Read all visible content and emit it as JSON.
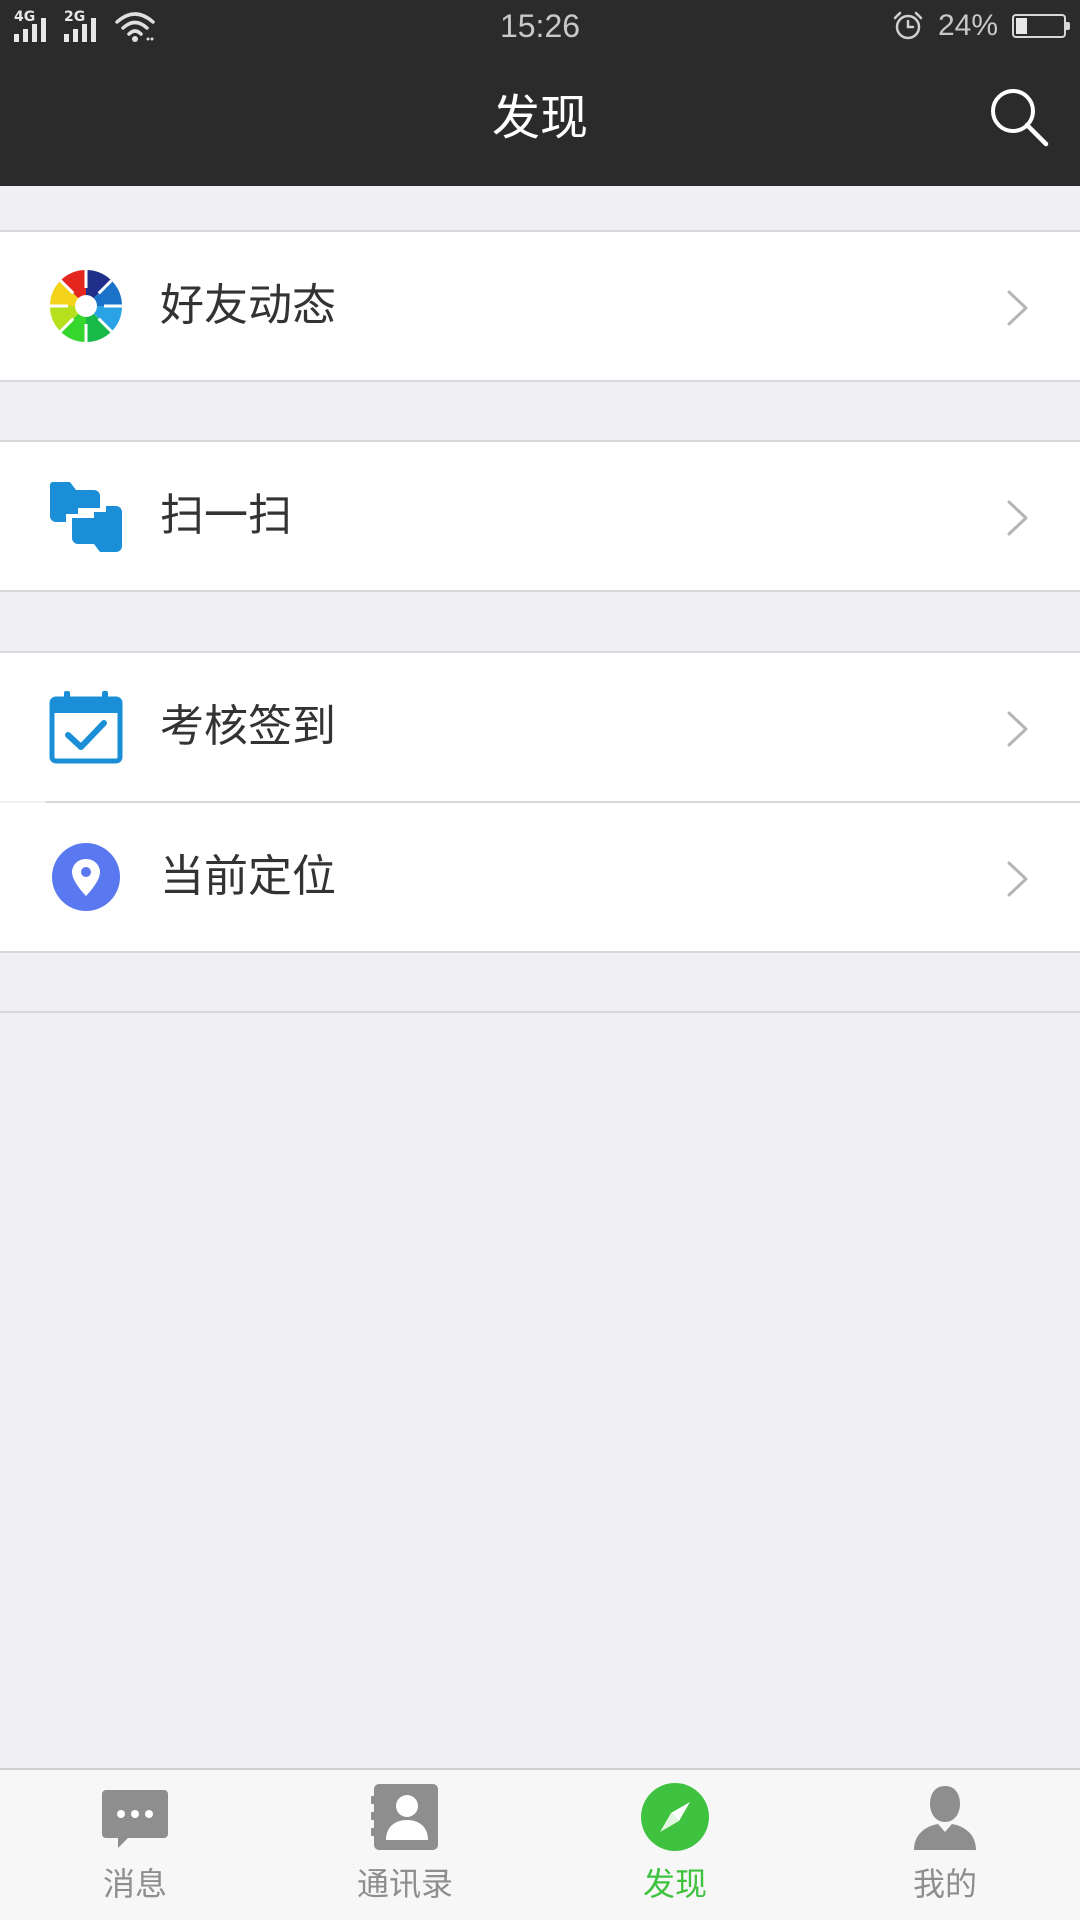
{
  "status_bar": {
    "network_1": "4G",
    "network_2": "2G",
    "time": "15:26",
    "battery_text": "24%",
    "battery_level": 0.24,
    "icons": [
      "signal-icon",
      "wifi-icon",
      "alarm-icon",
      "battery-icon"
    ]
  },
  "header": {
    "title": "发现",
    "search_icon": "search-icon"
  },
  "list": {
    "items": [
      {
        "label": "好友动态",
        "icon": "aperture-icon"
      },
      {
        "label": "扫一扫",
        "icon": "scan-icon"
      },
      {
        "label": "考核签到",
        "icon": "calendar-check-icon"
      },
      {
        "label": "当前定位",
        "icon": "location-pin-icon"
      }
    ],
    "chevron_icon": "chevron-right-icon"
  },
  "tabbar": {
    "tabs": [
      {
        "label": "消息",
        "icon": "chat-bubble-icon",
        "active": false
      },
      {
        "label": "通讯录",
        "icon": "contacts-icon",
        "active": false
      },
      {
        "label": "发现",
        "icon": "compass-icon",
        "active": true
      },
      {
        "label": "我的",
        "icon": "person-icon",
        "active": false
      }
    ]
  },
  "colors": {
    "header_bg": "#2b2b2b",
    "page_bg": "#efeff4",
    "active_tab": "#3fc23f",
    "inactive_tab": "#8e8e8e",
    "scan_blue": "#1a8fd8",
    "location_blue": "#5a78f0"
  }
}
